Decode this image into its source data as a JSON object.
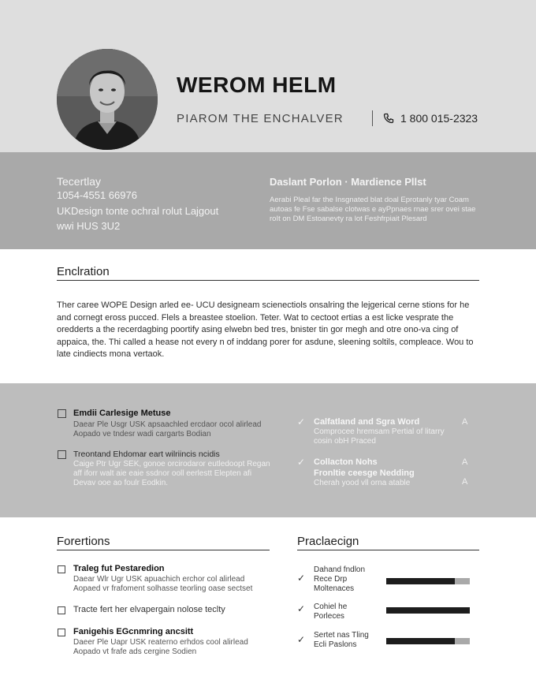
{
  "header": {
    "name": "WEROM HELM",
    "subtitle": "PIAROM THE ENCHALVER",
    "phone": "1 800 015-2323"
  },
  "contact": {
    "lines": [
      "Tecertlay",
      "1054-4551 66976",
      "UKDesign tonte ochral rolut Lajgout",
      "wwi HUS 3U2"
    ],
    "title": "Daslant Porlon · Mardience Pllst",
    "para": "Aerabi Pleal far the Insgnated blat doal Eprotanly tyar Coam autoas fe Fse sabalse clotwas e ayPpnaes rnae srer ovei stae roIt on DM Estoanevty ra lot Feshfrpiait Plesard"
  },
  "summary": {
    "title": "Enclration",
    "text": "Ther caree WOPE Design arled ee- UCU designeam scienectiols onsalring the lejgerical cerne stions for he and cornegt eross pucced. Flels a breastee stoelion. Teter. Wat to cectoot ertias a est licke vesprate the oredderts a the recerdagbing poortify asing elwebn bed tres, bnister tin gor megh and otre ono-va cing of appaica, the. Thi called a hease not every n of inddang porer for asdune, sleening soltils, compleace. Wou to late cindiects mona vertaok."
  },
  "experience": {
    "items": [
      {
        "title": "Emdii Carlesige Metuse",
        "desc": "Daear Ple Usgr USK apsaachled ercdaor ocol alirlead Aopado ve tndesr wadi cargarts Bodian"
      },
      {
        "title": "Treontand Ehdomar eart wilriincis ncidis",
        "desc": "Caige Ptr Ugr SEK, gonoe orcirodaror eutledoopt Regan aff iforr walt aie eaie ssdnor ooll eerlestt Elepten afi Devav ooe ao foulr Eodkin."
      }
    ],
    "achievements": [
      {
        "title": "Calfatland and Sgra Word",
        "desc": "Comprocee hremsam Pertial of litarry cosin obH Praced",
        "mark": "A"
      },
      {
        "title": "Collacton Nohs",
        "subtitle": "Fronltie ceesge Nedding",
        "desc": "Cherah yood vll orna atable",
        "mark": "A",
        "mark2": "A"
      }
    ]
  },
  "positions": {
    "title": "Forertions",
    "items": [
      {
        "title": "Traleg fut Pestaredion",
        "desc": "Daear Wlr Ugr USK apuachich erchor col alirlead Aopaed vr frafoment solhasse teorling oase sectset"
      },
      {
        "plain": "Tracte fert her elvapergain nolose teclty"
      },
      {
        "title": "Fanigehis EGcnmring ancsitt",
        "desc": "Daeer Ple Uapr USK reaterno erhdos cool alirlead Aopado vt frafe ads cergine Sodien"
      }
    ]
  },
  "skills": {
    "title": "Praclaecign",
    "items": [
      {
        "label": "Dahand fndlon Rece Drp Moltenaces",
        "level": 0.82
      },
      {
        "label": "Cohiel he Porleces",
        "level": 1.0
      },
      {
        "label": "Sertet nas Tling Ecli Paslons",
        "level": 0.82
      }
    ]
  }
}
